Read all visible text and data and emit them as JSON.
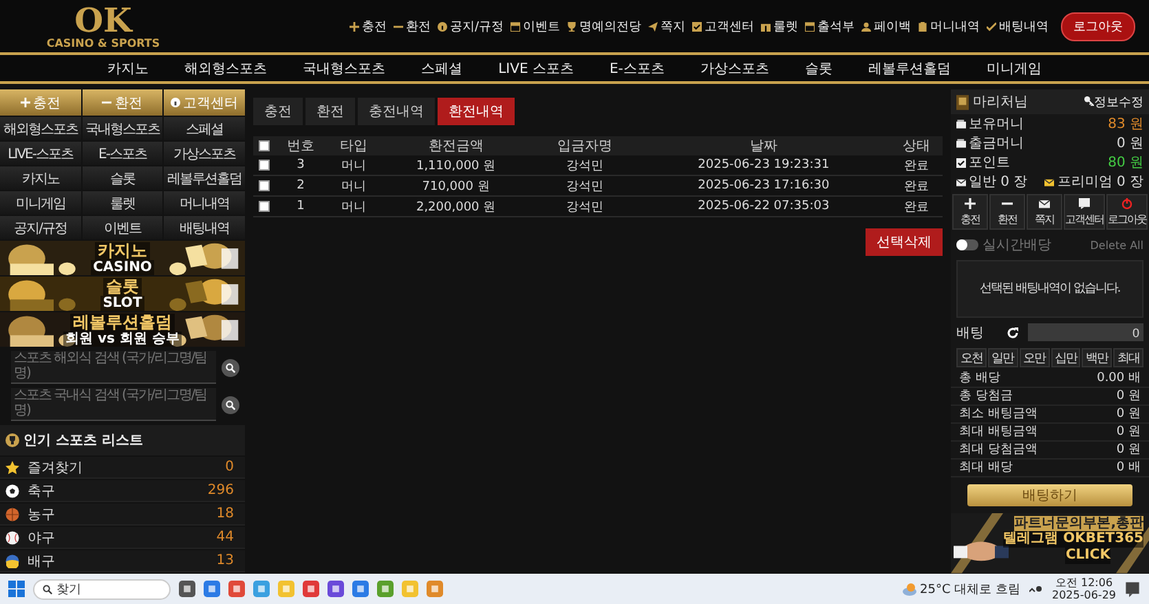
{
  "logo": {
    "title": "OK",
    "subtitle": "CASINO & SPORTS"
  },
  "top_menu": [
    "충전",
    "환전",
    "공지/규정",
    "이벤트",
    "명예의전당",
    "쪽지",
    "고객센터",
    "룰렛",
    "출석부",
    "페이백",
    "머니내역",
    "배팅내역"
  ],
  "logout_button": "로그아웃",
  "nav": [
    "카지노",
    "해외형스포츠",
    "국내형스포츠",
    "스페셜",
    "LIVE 스포츠",
    "E-스포츠",
    "가상스포츠",
    "슬롯",
    "레볼루션홀덤",
    "미니게임"
  ],
  "sidebar": {
    "quick_buttons": [
      {
        "kind": "plus",
        "label": "충전"
      },
      {
        "kind": "minus",
        "label": "환전"
      },
      {
        "kind": "help",
        "label": "고객센터"
      }
    ],
    "grid": [
      "해외형스포츠",
      "국내형스포츠",
      "스페셜",
      "LIVE-스포츠",
      "E-스포츠",
      "가상스포츠",
      "카지노",
      "슬롯",
      "레볼루션홀덤",
      "미니게임",
      "룰렛",
      "머니내역",
      "공지/규정",
      "이벤트",
      "배팅내역"
    ],
    "banners": [
      {
        "title": "카지노",
        "subtitle": "CASINO"
      },
      {
        "title": "슬롯",
        "subtitle": "SLOT"
      },
      {
        "title": "레볼루션홀덤",
        "subtitle": "회원 vs 회원 승부"
      }
    ],
    "searches": [
      {
        "placeholder": "스포츠 해외식 검색 (국가/리그명/팀명)"
      },
      {
        "placeholder": "스포츠 국내식 검색 (국가/리그명/팀명)"
      }
    ],
    "sports_title": "인기 스포츠 리스트",
    "sports": [
      {
        "kind": "star",
        "name": "즐겨찾기",
        "count": "0"
      },
      {
        "kind": "soccer",
        "name": "축구",
        "count": "296"
      },
      {
        "kind": "basketball",
        "name": "농구",
        "count": "18"
      },
      {
        "kind": "baseball",
        "name": "야구",
        "count": "44"
      },
      {
        "kind": "volleyball",
        "name": "배구",
        "count": "13"
      }
    ]
  },
  "tabs": [
    {
      "label": "충전",
      "selected": false
    },
    {
      "label": "환전",
      "selected": false
    },
    {
      "label": "충전내역",
      "selected": false
    },
    {
      "label": "환전내역",
      "selected": true
    }
  ],
  "table": {
    "header_checked": false,
    "columns": [
      "번호",
      "타입",
      "환전금액",
      "입금자명",
      "날짜",
      "상태"
    ],
    "rows": [
      {
        "checked": false,
        "cells": [
          "3",
          "머니",
          "1,110,000 원",
          "강석민",
          "2025-06-23 19:23:31",
          "완료"
        ]
      },
      {
        "checked": false,
        "cells": [
          "2",
          "머니",
          "710,000 원",
          "강석민",
          "2025-06-23 17:16:30",
          "완료"
        ]
      },
      {
        "checked": false,
        "cells": [
          "1",
          "머니",
          "2,200,000 원",
          "강석민",
          "2025-06-22 07:35:03",
          "완료"
        ]
      }
    ]
  },
  "delete_button": "선택삭제",
  "user_panel": {
    "username": "마리처님",
    "edit_link": "정보수정",
    "balances": [
      {
        "label": "보유머니",
        "value": "83 원"
      },
      {
        "label": "출금머니",
        "value": "0 원"
      },
      {
        "label": "포인트",
        "value": "80 원"
      }
    ],
    "messages": [
      {
        "label": "일반 0 장"
      },
      {
        "label": "프리미엄 0 장"
      }
    ],
    "buttons": [
      {
        "kind": "plus",
        "label": "충전"
      },
      {
        "kind": "minus",
        "label": "환전"
      },
      {
        "kind": "mail",
        "label": "쪽지"
      },
      {
        "kind": "chat",
        "label": "고객센터"
      },
      {
        "kind": "power",
        "label": "로그아웃"
      }
    ],
    "live_odds": {
      "label": "실시간배당",
      "on": false
    },
    "delete_all": "Delete All",
    "empty_message": "선택된 배팅내역이 없습니다.",
    "bet_label": "배팅",
    "bet_value": "0",
    "amounts": [
      "오천",
      "일만",
      "오만",
      "십만",
      "백만",
      "최대"
    ],
    "summary": [
      {
        "label": "총 배당",
        "value": "0.00 배"
      },
      {
        "label": "총 당첨금",
        "value": "0 원"
      },
      {
        "label": "최소 배팅금액",
        "value": "0 원"
      },
      {
        "label": "최대 배팅금액",
        "value": "0 원"
      },
      {
        "label": "최대 당첨금액",
        "value": "0 원"
      },
      {
        "label": "최대 배당",
        "value": "0 배"
      }
    ],
    "bet_button": "배팅하기"
  },
  "ad": {
    "line1": "파트너문의부본,총판",
    "line2": "텔레그램 OKBET365",
    "line3": "CLICK"
  },
  "taskbar": {
    "search": "찾기",
    "weather": "25°C 대체로 흐림",
    "time": "오전 12:06",
    "date": "2025-06-29"
  }
}
